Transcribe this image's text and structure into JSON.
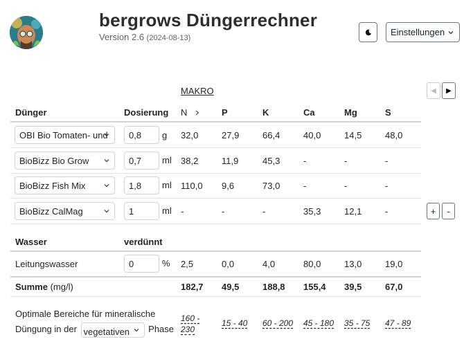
{
  "header": {
    "title": "bergrows Düngerrechner",
    "version": "Version 2.6",
    "date": "(2024-08-13)",
    "settings_label": "Einstellungen",
    "theme_icon": "moon-icon"
  },
  "section_label": "MAKRO",
  "nav": {
    "prev_icon": "triangle-left-icon",
    "next_icon": "triangle-right-icon"
  },
  "table": {
    "col_fertilizer": "Dünger",
    "col_dosage": "Dosierung",
    "nutrients": [
      "N",
      "P",
      "K",
      "Ca",
      "Mg",
      "S"
    ],
    "rows": [
      {
        "name": "OBI Bio Tomaten- und",
        "dose": "0,8",
        "unit": "g",
        "values": [
          "32,0",
          "27,9",
          "66,4",
          "40,0",
          "14,5",
          "48,0"
        ]
      },
      {
        "name": "BioBizz Bio Grow",
        "dose": "0,7",
        "unit": "ml",
        "values": [
          "38,2",
          "11,9",
          "45,3",
          "-",
          "-",
          "-"
        ]
      },
      {
        "name": "BioBizz Fish Mix",
        "dose": "1,8",
        "unit": "ml",
        "values": [
          "110,0",
          "9,6",
          "73,0",
          "-",
          "-",
          "-"
        ]
      },
      {
        "name": "BioBizz CalMag",
        "dose": "1",
        "unit": "ml",
        "values": [
          "-",
          "-",
          "-",
          "35,3",
          "12,1",
          "-"
        ]
      }
    ],
    "add_label": "+",
    "remove_label": "-"
  },
  "water": {
    "label": "Wasser",
    "dilution_label": "verdünnt",
    "source": "Leitungswasser",
    "dilution": "0",
    "dilution_unit": "%",
    "values": [
      "2,5",
      "0,0",
      "4,0",
      "80,0",
      "13,0",
      "19,0"
    ]
  },
  "sum": {
    "label": "Summe",
    "unit": "(mg/l)",
    "values": [
      "182,7",
      "49,5",
      "188,8",
      "155,4",
      "39,5",
      "67,0"
    ]
  },
  "optimal": {
    "text1": "Optimale Bereiche für mineralische",
    "text2": "Düngung in der",
    "phase": "vegetativen",
    "text3": "Phase",
    "ranges": [
      "160 - 230",
      "15 - 40",
      "60 - 200",
      "45 - 180",
      "35 - 75",
      "47 - 89"
    ]
  }
}
